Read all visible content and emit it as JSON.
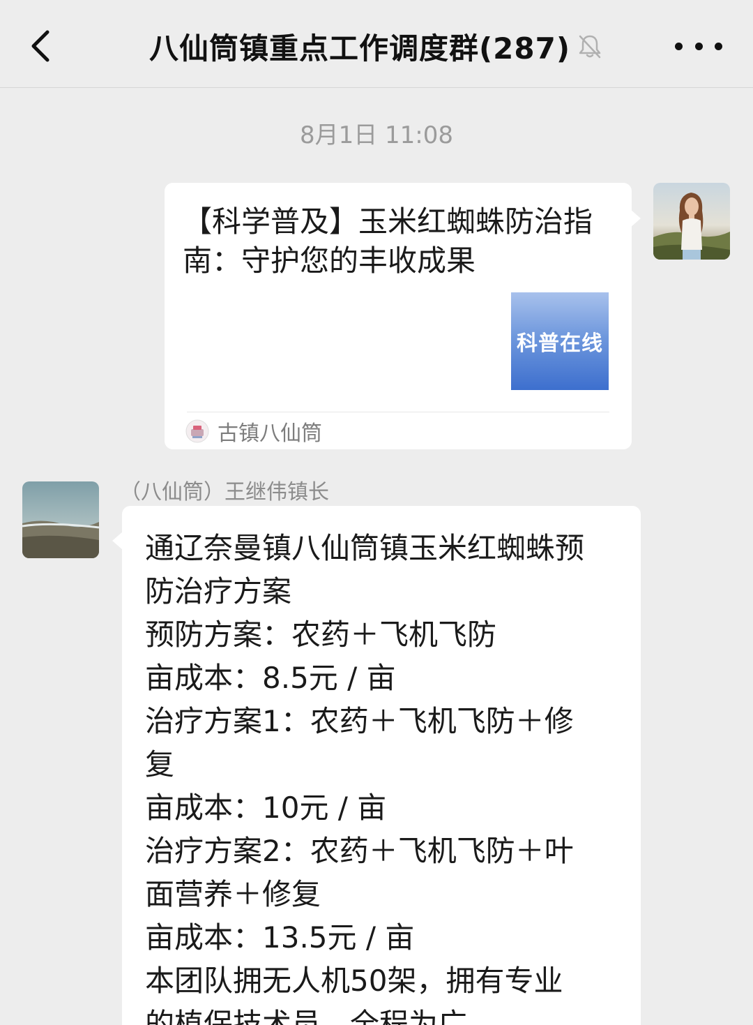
{
  "header": {
    "title": "八仙筒镇重点工作调度群(287)",
    "back_icon": "chevron-left-icon",
    "mute_icon": "bell-muted-icon",
    "more_icon": "more-dots-icon"
  },
  "timestamp": "8月1日 11:08",
  "messages": {
    "card": {
      "title_lines": [
        "【科学普及】玉米红蜘蛛防治指",
        "南：守护您的丰收成果"
      ],
      "thumbnail_text": "科普在线",
      "source_name": "古镇八仙筒"
    },
    "text": {
      "sender": "（八仙筒）王继伟镇长",
      "lines": [
        "通辽奈曼镇八仙筒镇玉米红蜘蛛预",
        "防治疗方案",
        "预防方案：农药＋飞机飞防",
        "亩成本：8.5元 / 亩",
        "治疗方案1：农药＋飞机飞防＋修",
        "复",
        "亩成本：10元 / 亩",
        "治疗方案2：农药＋飞机飞防＋叶",
        "面营养＋修复",
        "亩成本：13.5元 / 亩",
        "本团队拥无人机50架，拥有专业",
        "的植保技术员，全程为广"
      ]
    }
  },
  "colors": {
    "background": "#ededed",
    "bubble": "#ffffff",
    "timestamp": "#9b9b9b",
    "thumbnail_blue": "#3d6fce"
  }
}
